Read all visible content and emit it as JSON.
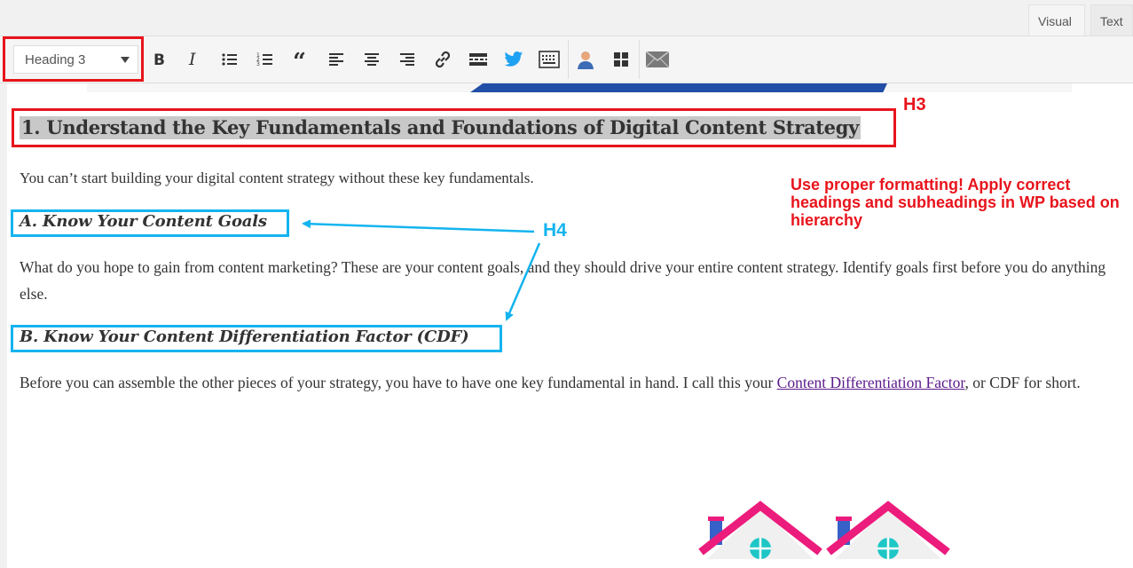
{
  "tabs": {
    "visual": "Visual",
    "text": "Text"
  },
  "toolbar": {
    "format_select": "Heading 3",
    "buttons": [
      {
        "name": "bold-button",
        "icon": "bold-icon"
      },
      {
        "name": "italic-button",
        "icon": "italic-icon"
      },
      {
        "name": "bullet-list-button",
        "icon": "bullet-list-icon"
      },
      {
        "name": "numbered-list-button",
        "icon": "numbered-list-icon"
      },
      {
        "name": "blockquote-button",
        "icon": "blockquote-icon"
      },
      {
        "name": "align-left-button",
        "icon": "align-left-icon"
      },
      {
        "name": "align-center-button",
        "icon": "align-center-icon"
      },
      {
        "name": "align-right-button",
        "icon": "align-right-icon"
      },
      {
        "name": "insert-link-button",
        "icon": "link-icon"
      },
      {
        "name": "read-more-button",
        "icon": "read-more-icon"
      },
      {
        "name": "twitter-button",
        "icon": "twitter-icon"
      },
      {
        "name": "keyboard-button",
        "icon": "keyboard-icon"
      },
      {
        "name": "author-box-button",
        "icon": "person-icon"
      },
      {
        "name": "grid-button",
        "icon": "grid-icon"
      },
      {
        "name": "email-button",
        "icon": "envelope-icon"
      }
    ]
  },
  "content": {
    "h3": "1. Understand the Key Fundamentals and Foundations of Digital Content Strategy",
    "p1": "You can’t start building your digital content strategy without these key fundamentals.",
    "h4a": "A. Know Your Content Goals",
    "p2": "What do you hope to gain from content marketing? These are your content goals, and they should drive your entire content strategy. Identify goals first before you do anything else.",
    "h4b": "B. Know Your Content Differentiation Factor (CDF)",
    "p3_before": "Before you can assemble the other pieces of your strategy, you have to have one key fundamental in hand. I call this your ",
    "p3_link": "Content Differentiation Factor",
    "p3_after": ", or CDF for short."
  },
  "annotations": {
    "h3_label": "H3",
    "h4_label": "H4",
    "note": "Use proper formatting! Apply correct headings and subheadings in WP based on hierarchy"
  },
  "colors": {
    "annotation_red": "#e8141c",
    "annotation_blue": "#14b4ef",
    "link_purple": "#5b1a8c"
  }
}
